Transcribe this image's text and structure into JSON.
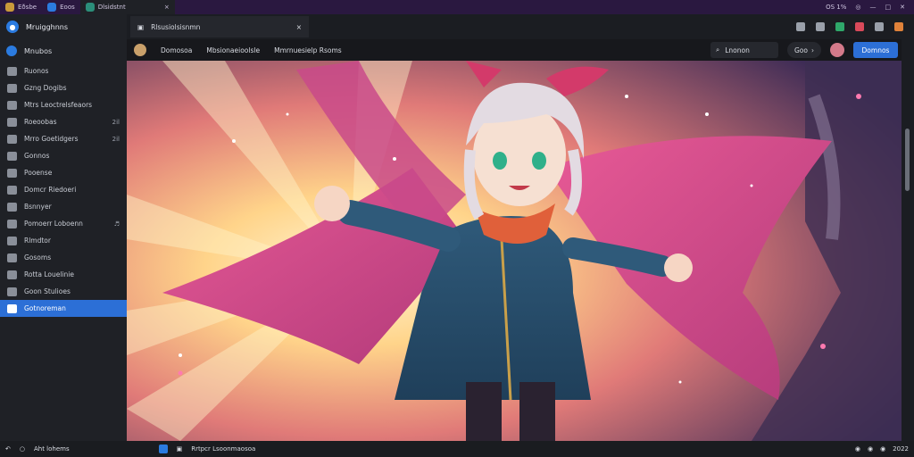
{
  "titlebar": {
    "tabs": [
      {
        "label": "Eðsbe",
        "color": "#c99a3a"
      },
      {
        "label": "Eoos",
        "color": "#2b7be0"
      },
      {
        "label": "Dlsidstnt",
        "color": "#2b8f7a",
        "close": "×"
      }
    ],
    "win": {
      "right_label": "OS 1%"
    }
  },
  "sidebar": {
    "header": "Mruigghnns",
    "section": "Mnubos",
    "items": [
      {
        "label": "Ruonos"
      },
      {
        "label": "Gzng Dogibs"
      },
      {
        "label": "Mtrs Leoctrelsfeaors"
      },
      {
        "label": "Roeoobas",
        "badge": "2il"
      },
      {
        "label": "Mrro Goetidgers",
        "badge": "2il"
      },
      {
        "label": "Gonnos"
      },
      {
        "label": "Pooense"
      },
      {
        "label": "Domcr Riedoeri"
      },
      {
        "label": "Bsnnyer"
      },
      {
        "label": "Pomoerr Loboenn",
        "badge": "♬"
      },
      {
        "label": "Rlmdtor"
      },
      {
        "label": "Gosoms"
      },
      {
        "label": "Rotta Louelinie"
      },
      {
        "label": "Goon Stulioes"
      },
      {
        "label": "Gotnoreman",
        "active": true
      }
    ]
  },
  "topbar": {
    "doc_tab": "Rlsusiolsisnmn",
    "close": "×",
    "icons": [
      "#9aa0aa",
      "#9aa0aa",
      "#2fa86a",
      "#d94a5a",
      "#9aa0aa",
      "#e0823a"
    ]
  },
  "navbar": {
    "items": [
      "Domosoa",
      "Mbsionaeioolsle",
      "Mmrnuesielp Rsoms"
    ],
    "search": "Lnonon",
    "pill": "Goo",
    "primary": "Domnos"
  },
  "statusbar": {
    "left": "Aht lohems",
    "mid": "Rrtpcr Lsoonmaosoa",
    "right": "2022"
  }
}
